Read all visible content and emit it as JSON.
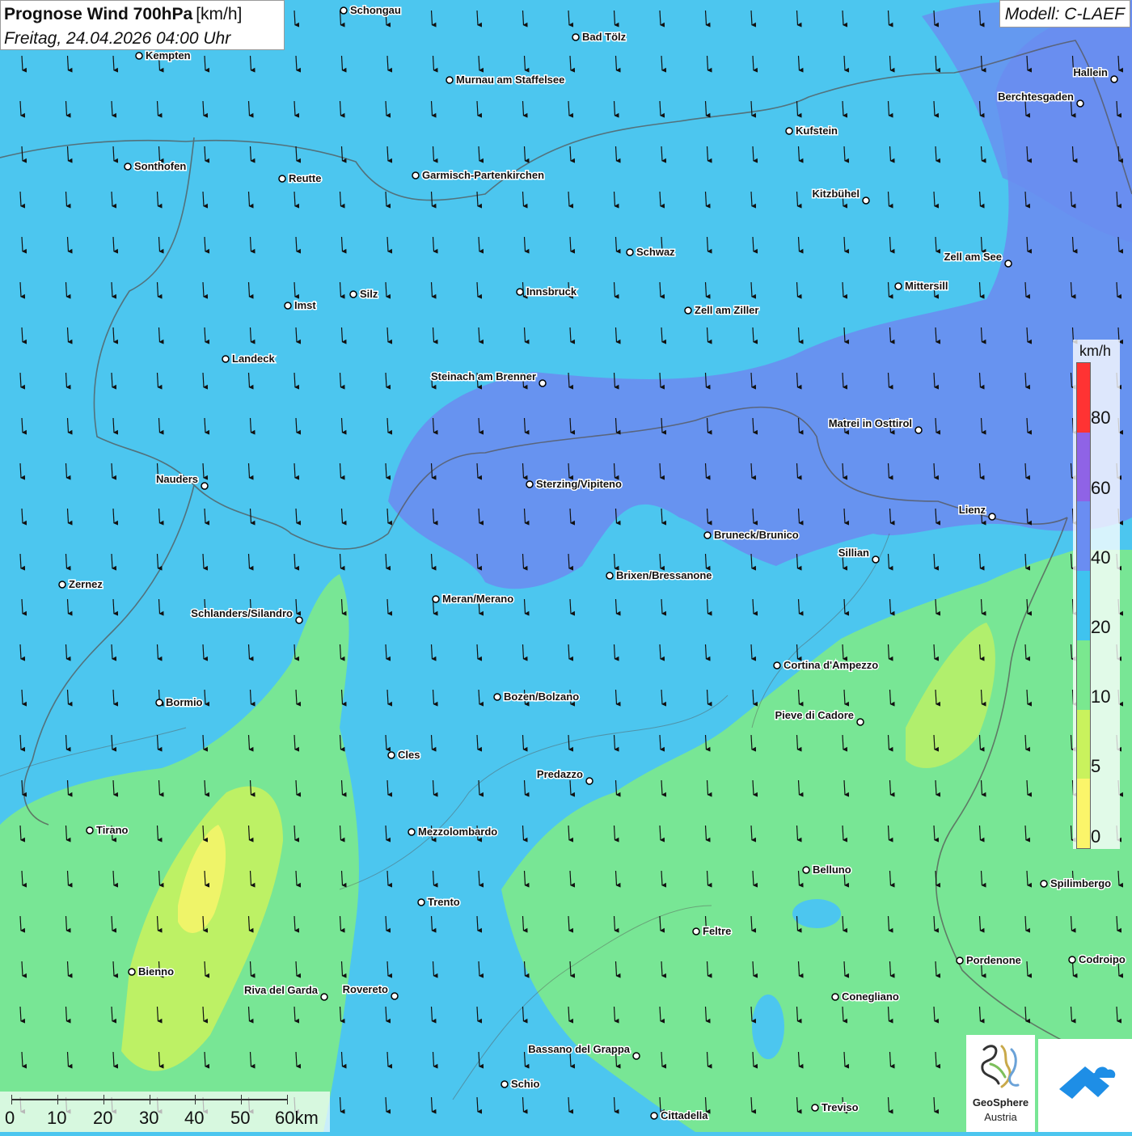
{
  "header": {
    "title": "Prognose Wind 700hPa",
    "unit": "[km/h]",
    "datetime": "Freitag, 24.04.2026 04:00 Uhr",
    "model": "Modell: C-LAEF"
  },
  "legend": {
    "unit": "km/h",
    "labels": [
      "80",
      "60",
      "40",
      "20",
      "10",
      "5",
      "0"
    ],
    "colors": [
      "#ff3333",
      "#8f63e6",
      "#6a8df2",
      "#3fc3ef",
      "#7ae88f",
      "#c9f25d",
      "#fbf56a"
    ]
  },
  "scalebar": {
    "labels": [
      "0",
      "10",
      "20",
      "30",
      "40",
      "50",
      "60km"
    ]
  },
  "logo": {
    "name_bold": "GeoSphere",
    "name_sub": "Austria"
  },
  "wind": {
    "direction": "north",
    "grid_cols": 25,
    "grid_rows": 25
  },
  "cities": [
    {
      "name": "Schongau"
    },
    {
      "name": "Bad Tölz"
    },
    {
      "name": "Kempten"
    },
    {
      "name": "Murnau am Staffelsee"
    },
    {
      "name": "Hallein"
    },
    {
      "name": "Berchtesgaden"
    },
    {
      "name": "Kufstein"
    },
    {
      "name": "Sonthofen"
    },
    {
      "name": "Reutte"
    },
    {
      "name": "Garmisch-Partenkirchen"
    },
    {
      "name": "Kitzbühel"
    },
    {
      "name": "Schwaz"
    },
    {
      "name": "Zell am See"
    },
    {
      "name": "Mittersill"
    },
    {
      "name": "Innsbruck"
    },
    {
      "name": "Silz"
    },
    {
      "name": "Imst"
    },
    {
      "name": "Zell am Ziller"
    },
    {
      "name": "Landeck"
    },
    {
      "name": "Steinach am Brenner"
    },
    {
      "name": "Matrei in Osttirol"
    },
    {
      "name": "Nauders"
    },
    {
      "name": "Sterzing/Vipiteno"
    },
    {
      "name": "Lienz"
    },
    {
      "name": "Bruneck/Brunico"
    },
    {
      "name": "Sillian"
    },
    {
      "name": "Brixen/Bressanone"
    },
    {
      "name": "Zernez"
    },
    {
      "name": "Meran/Merano"
    },
    {
      "name": "Schlanders/Silandro"
    },
    {
      "name": "Cortina d'Ampezzo"
    },
    {
      "name": "Bozen/Bolzano"
    },
    {
      "name": "Bormio"
    },
    {
      "name": "Pieve di Cadore"
    },
    {
      "name": "Cles"
    },
    {
      "name": "Predazzo"
    },
    {
      "name": "Tirano"
    },
    {
      "name": "Mezzolombardo"
    },
    {
      "name": "Belluno"
    },
    {
      "name": "Spilimbergo"
    },
    {
      "name": "Trento"
    },
    {
      "name": "Feltre"
    },
    {
      "name": "Bienno"
    },
    {
      "name": "Pordenone"
    },
    {
      "name": "Codroipo"
    },
    {
      "name": "Riva del Garda"
    },
    {
      "name": "Rovereto"
    },
    {
      "name": "Conegliano"
    },
    {
      "name": "Bassano del Grappa"
    },
    {
      "name": "Schio"
    },
    {
      "name": "Treviso"
    },
    {
      "name": "Cittadella"
    }
  ]
}
